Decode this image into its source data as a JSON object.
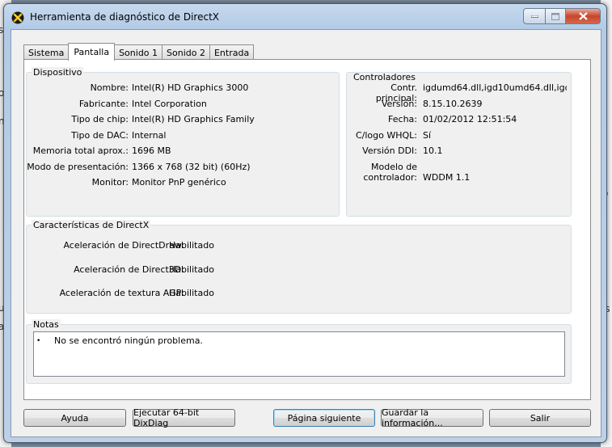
{
  "window": {
    "title": "Herramienta de diagnóstico de DirectX"
  },
  "background": {
    "left_glyphs": [
      "s",
      "o",
      "n",
      "u",
      "a"
    ],
    "right_glyphs": [
      "o",
      "es"
    ]
  },
  "tabs": [
    {
      "label": "Sistema",
      "active": false
    },
    {
      "label": "Pantalla",
      "active": true
    },
    {
      "label": "Sonido 1",
      "active": false
    },
    {
      "label": "Sonido 2",
      "active": false
    },
    {
      "label": "Entrada",
      "active": false
    }
  ],
  "dispositivo": {
    "title": "Dispositivo",
    "rows": [
      {
        "label": "Nombre:",
        "value": "Intel(R) HD Graphics 3000"
      },
      {
        "label": "Fabricante:",
        "value": "Intel Corporation"
      },
      {
        "label": "Tipo de chip:",
        "value": "Intel(R) HD Graphics Family"
      },
      {
        "label": "Tipo de DAC:",
        "value": "Internal"
      },
      {
        "label": "Memoria total aprox.:",
        "value": "1696 MB"
      },
      {
        "label": "Modo de presentación:",
        "value": "1366 x 768 (32 bit) (60Hz)"
      },
      {
        "label": "Monitor:",
        "value": "Monitor PnP genérico"
      }
    ]
  },
  "controladores": {
    "title": "Controladores",
    "rows": [
      {
        "label": "Contr. principal:",
        "value": "igdumd64.dll,igd10umd64.dll,igd10um"
      },
      {
        "label": "Versión:",
        "value": "8.15.10.2639"
      },
      {
        "label": "Fecha:",
        "value": "01/02/2012 12:51:54"
      },
      {
        "label": "C/logo WHQL:",
        "value": "Sí"
      },
      {
        "label": "Versión DDI:",
        "value": "10.1"
      }
    ],
    "modelo_label_line1": "Modelo de",
    "modelo_label_line2": "controlador:",
    "modelo_value": "WDDM 1.1"
  },
  "caracteristicas": {
    "title": "Características de DirectX",
    "rows": [
      {
        "label": "Aceleración de DirectDraw:",
        "value": "Habilitado"
      },
      {
        "label": "Aceleración de Direct3D:",
        "value": "Habilitado"
      },
      {
        "label": "Aceleración de textura AGP:",
        "value": "Habilitado"
      }
    ]
  },
  "notas": {
    "title": "Notas",
    "bullet": "•",
    "items": [
      "No se encontró ningún problema."
    ]
  },
  "buttons": {
    "help": "Ayuda",
    "run64": "Ejecutar 64-bit DixDiag",
    "next_page": "Página siguiente",
    "save_info": "Guardar la información...",
    "exit": "Salir"
  },
  "colors": {
    "close_button": "#c7452c",
    "title_bar": "#b3cbe6",
    "default_button_border": "#3c7fb1"
  }
}
